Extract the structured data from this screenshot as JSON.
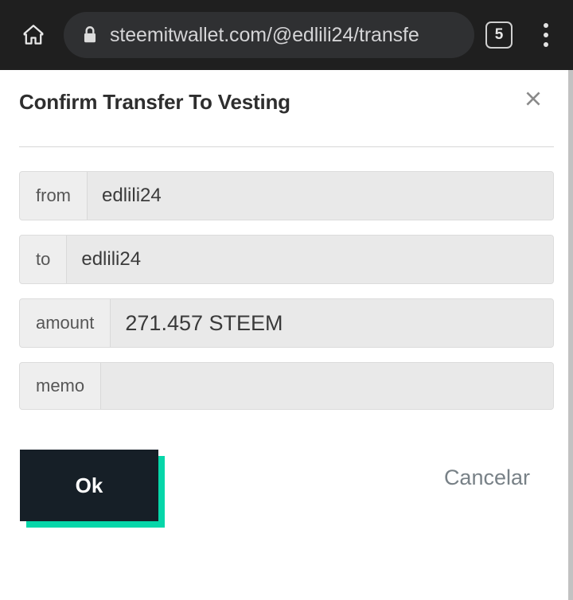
{
  "browser": {
    "home_icon": "home-icon",
    "lock_icon": "lock-icon",
    "url": "steemitwallet.com/@edlili24/transfe",
    "tab_count": "5",
    "menu_icon": "overflow-menu-icon"
  },
  "dialog": {
    "title": "Confirm Transfer To Vesting",
    "close_icon": "close-icon",
    "fields": [
      {
        "label": "from",
        "value": "edlili24"
      },
      {
        "label": "to",
        "value": "edlili24"
      },
      {
        "label": "amount",
        "value": "271.457 STEEM"
      },
      {
        "label": "memo",
        "value": ""
      }
    ],
    "ok_label": "Ok",
    "cancel_label": "Cancelar"
  },
  "colors": {
    "browser_bg": "#1f1f1f",
    "omnibox_bg": "#2f3032",
    "accent_teal": "#06d6a9",
    "button_dark": "#161f27",
    "field_label_bg": "#eeeeee",
    "field_value_bg": "#e9e9e9",
    "cancel_text": "#788187"
  }
}
